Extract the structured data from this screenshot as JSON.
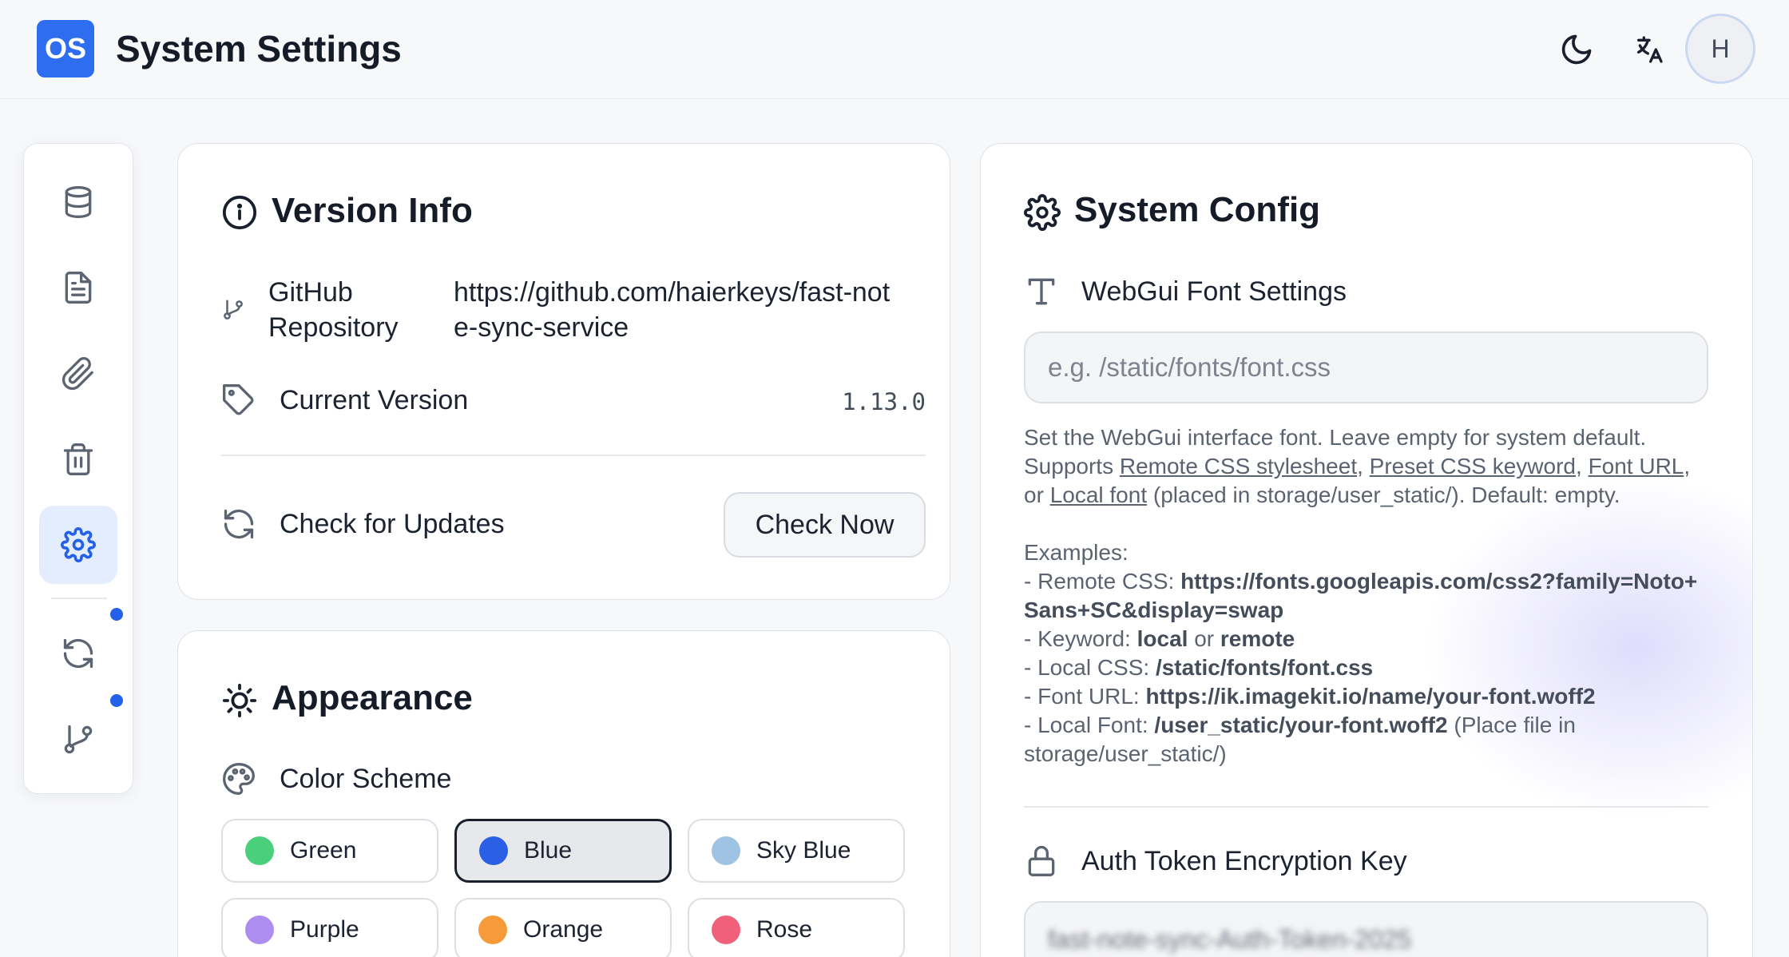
{
  "header": {
    "logo_text": "OS",
    "title": "System Settings",
    "theme_icon": "moon-icon",
    "language_icon": "translate-icon",
    "avatar_initial": "H"
  },
  "sidebar": {
    "items": [
      {
        "icon": "database-icon",
        "active": false
      },
      {
        "icon": "document-icon",
        "active": false
      },
      {
        "icon": "paperclip-icon",
        "active": false
      },
      {
        "icon": "trash-icon",
        "active": false
      },
      {
        "icon": "gear-icon",
        "active": true
      },
      {
        "icon": "sync-icon",
        "active": false,
        "badge": true
      },
      {
        "icon": "git-branch-icon",
        "active": false,
        "badge": true
      }
    ]
  },
  "version_info": {
    "title": "Version Info",
    "repo_label": "GitHub Repository",
    "repo_value": "https://github.com/haierkeys/fast-note-sync-service",
    "version_label": "Current Version",
    "version_value": "1.13.0",
    "update_label": "Check for Updates",
    "check_button": "Check Now"
  },
  "appearance": {
    "title": "Appearance",
    "color_scheme_label": "Color Scheme",
    "colors": [
      {
        "label": "Green",
        "color": "#4ad07a",
        "selected": false
      },
      {
        "label": "Blue",
        "color": "#2a5fe6",
        "selected": true
      },
      {
        "label": "Sky Blue",
        "color": "#9fc3e3",
        "selected": false
      },
      {
        "label": "Purple",
        "color": "#ad8ef0",
        "selected": false
      },
      {
        "label": "Orange",
        "color": "#f79a3a",
        "selected": false
      },
      {
        "label": "Rose",
        "color": "#f0607a",
        "selected": false
      }
    ]
  },
  "system_config": {
    "title": "System Config",
    "font_settings_label": "WebGui Font Settings",
    "font_input_placeholder": "e.g. /static/fonts/font.css",
    "desc_line1": "Set the WebGui interface font. Leave empty for system default.",
    "desc_supports": "Supports",
    "link_remote_css": "Remote CSS stylesheet",
    "link_preset_css": "Preset CSS keyword",
    "link_font_url": "Font URL",
    "desc_or": "or",
    "link_local_font": "Local font",
    "desc_tail": "(placed in storage/user_static/). Default: empty.",
    "examples_heading": "Examples:",
    "ex_remote_prefix": "- Remote CSS:",
    "ex_remote_value": "https://fonts.googleapis.com/css2?family=Noto+Sans+SC&display=swap",
    "ex_keyword_prefix": "- Keyword:",
    "ex_keyword_local": "local",
    "ex_keyword_or": "or",
    "ex_keyword_remote": "remote",
    "ex_localcss_prefix": "- Local CSS:",
    "ex_localcss_value": "/static/fonts/font.css",
    "ex_fonturl_prefix": "- Font URL:",
    "ex_fonturl_value": "https://ik.imagekit.io/name/your-font.woff2",
    "ex_localfont_prefix": "- Local Font:",
    "ex_localfont_value": "/user_static/your-font.woff2",
    "ex_localfont_tail": "(Place file in storage/user_static/)",
    "auth_key_label": "Auth Token Encryption Key",
    "auth_key_value": "fast-note-sync-Auth-Token-2025"
  }
}
